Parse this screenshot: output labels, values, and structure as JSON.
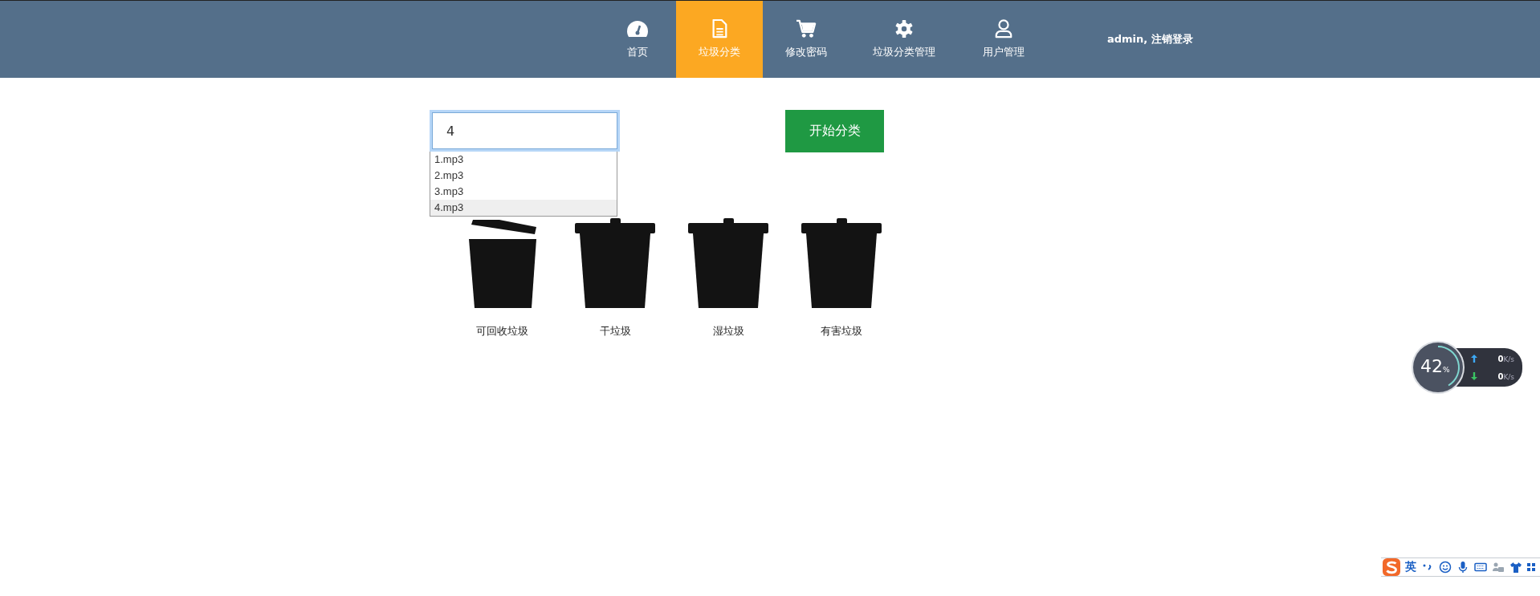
{
  "nav": {
    "items": [
      {
        "label": "首页",
        "selected": false
      },
      {
        "label": "垃圾分类",
        "selected": true
      },
      {
        "label": "修改密码",
        "selected": false
      },
      {
        "label": "垃圾分类管理",
        "selected": false
      },
      {
        "label": "用户管理",
        "selected": false
      }
    ],
    "user_text": "admin, 注销登录"
  },
  "search": {
    "value": "4",
    "suggestions": [
      {
        "label": "1.mp3",
        "selected": false
      },
      {
        "label": "2.mp3",
        "selected": false
      },
      {
        "label": "3.mp3",
        "selected": false
      },
      {
        "label": "4.mp3",
        "selected": true
      }
    ]
  },
  "start_button": "开始分类",
  "bins": [
    {
      "label": "可回收垃圾",
      "lid_open": true
    },
    {
      "label": "干垃圾",
      "lid_open": false
    },
    {
      "label": "湿垃圾",
      "lid_open": false
    },
    {
      "label": "有害垃圾",
      "lid_open": false
    }
  ],
  "speed_widget": {
    "percent": "42",
    "percent_unit": "%",
    "upload": "0",
    "upload_unit": "K/s",
    "download": "0",
    "download_unit": "K/s"
  },
  "ime_bar": {
    "mode": "英"
  }
}
